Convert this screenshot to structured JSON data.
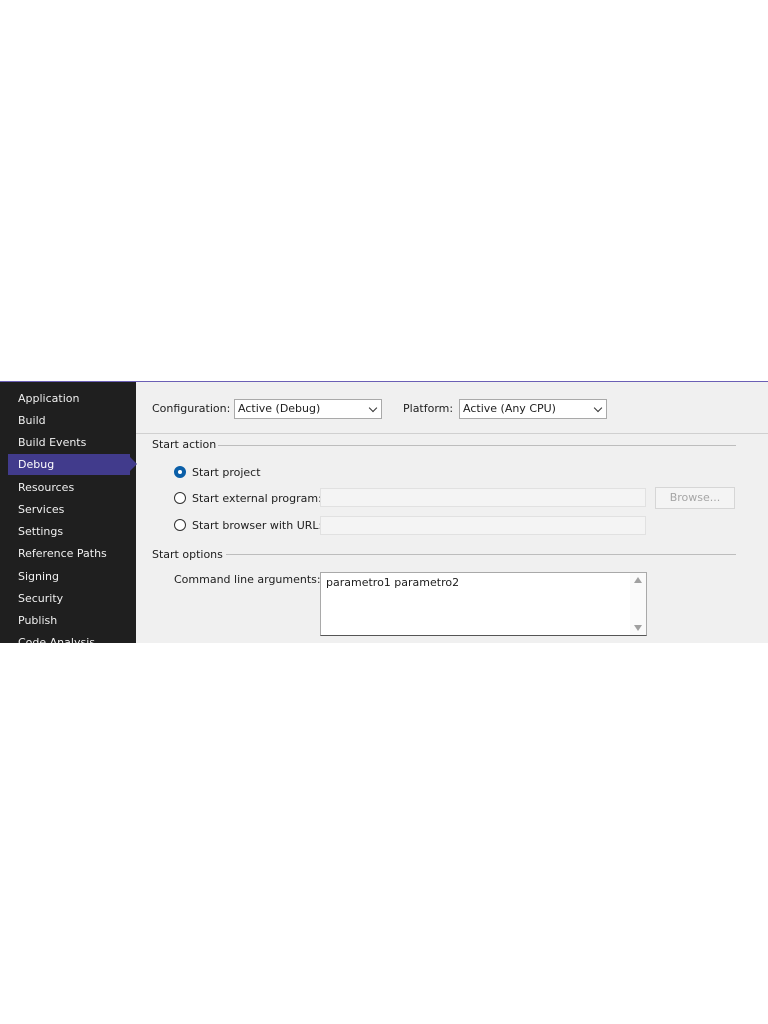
{
  "sidebar": {
    "items": [
      {
        "label": "Application"
      },
      {
        "label": "Build"
      },
      {
        "label": "Build Events"
      },
      {
        "label": "Debug",
        "active": true
      },
      {
        "label": "Resources"
      },
      {
        "label": "Services"
      },
      {
        "label": "Settings"
      },
      {
        "label": "Reference Paths"
      },
      {
        "label": "Signing"
      },
      {
        "label": "Security"
      },
      {
        "label": "Publish"
      },
      {
        "label": "Code Analysis"
      }
    ]
  },
  "config": {
    "configuration_label": "Configuration:",
    "configuration_value": "Active (Debug)",
    "platform_label": "Platform:",
    "platform_value": "Active (Any CPU)"
  },
  "start_action": {
    "title": "Start action",
    "options": [
      {
        "label": "Start project",
        "checked": true
      },
      {
        "label": "Start external program:",
        "checked": false
      },
      {
        "label": "Start browser with URL:",
        "checked": false
      }
    ],
    "browse_label": "Browse..."
  },
  "start_options": {
    "title": "Start options",
    "cmd_label": "Command line arguments:",
    "cmd_value": "parametro1 parametro2"
  },
  "colors": {
    "sidebar_bg": "#1f1f1f",
    "active_bg": "#413b8c",
    "radio_selected": "#0b5fa8",
    "panel_bg": "#f0f0f0"
  }
}
